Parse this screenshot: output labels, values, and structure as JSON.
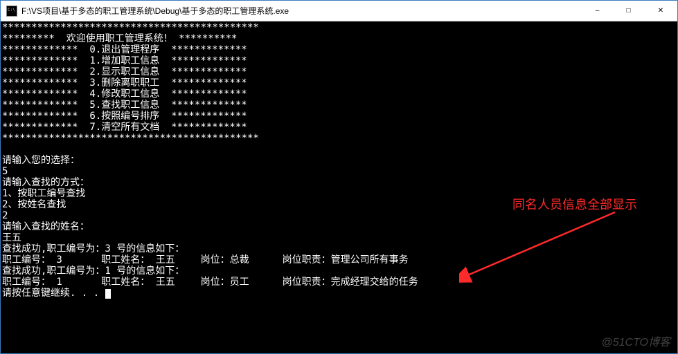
{
  "window": {
    "title": "F:\\VS项目\\基于多态的职工管理系统\\Debug\\基于多态的职工管理系统.exe",
    "icon_name": "console-app-icon"
  },
  "menu": {
    "header": "*********  欢迎使用职工管理系统！ **********",
    "items": [
      "*************  0.退出管理程序  *************",
      "*************  1.增加职工信息  *************",
      "*************  2.显示职工信息  *************",
      "*************  3.删除离职职工  *************",
      "*************  4.修改职工信息  *************",
      "*************  5.查找职工信息  *************",
      "*************  6.按照编号排序  *************",
      "*************  7.清空所有文档  *************"
    ],
    "border_top": "********************************************",
    "border_bottom": "********************************************"
  },
  "prompts": {
    "choose": "请输入您的选择：",
    "choose_value": "5",
    "search_mode": "请输入查找的方式：",
    "search_mode_opt1": "1、按职工编号查找",
    "search_mode_opt2": "2、按姓名查找",
    "search_mode_value": "2",
    "enter_name": "请输入查找的姓名：",
    "name_value": "王五"
  },
  "results": [
    {
      "found_line": "查找成功,职工编号为：3 号的信息如下：",
      "detail": "职工编号： 3\t 职工姓名： 王五\t  岗位：总裁\t岗位职责：管理公司所有事务"
    },
    {
      "found_line": "查找成功,职工编号为：1 号的信息如下：",
      "detail": "职工编号： 1\t 职工姓名： 王五\t  岗位：员工\t岗位职责：完成经理交给的任务"
    }
  ],
  "continue_prompt": "请按任意键继续. . . ",
  "annotation_text": "同名人员信息全部显示",
  "annotation_color": "#ff2a2a",
  "watermark": "@51CTO博客"
}
